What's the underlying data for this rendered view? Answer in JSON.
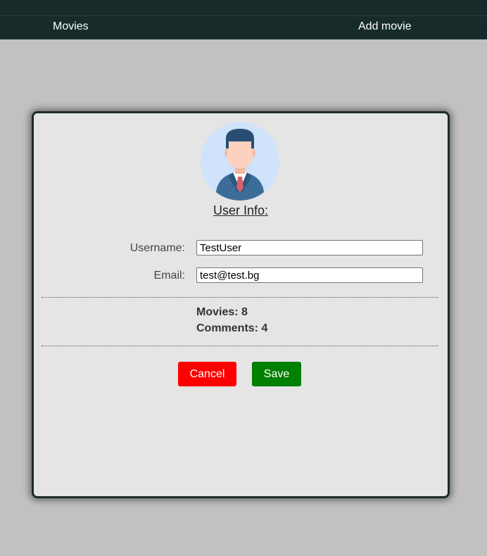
{
  "nav": {
    "movies_label": "Movies",
    "add_movie_label": "Add movie"
  },
  "profile": {
    "title": "User Info:",
    "username_label": "Username:",
    "username_value": "TestUser",
    "email_label": "Email:",
    "email_value": "test@test.bg",
    "movies_stat": "Movies: 8",
    "comments_stat": "Comments: 4",
    "avatar_icon": "user-avatar-icon"
  },
  "actions": {
    "cancel_label": "Cancel",
    "save_label": "Save"
  },
  "colors": {
    "background": "#c1c1c1",
    "navbar": "#172b2b",
    "card": "#e5e5e5",
    "cancel": "#ff0000",
    "save": "#008000"
  }
}
